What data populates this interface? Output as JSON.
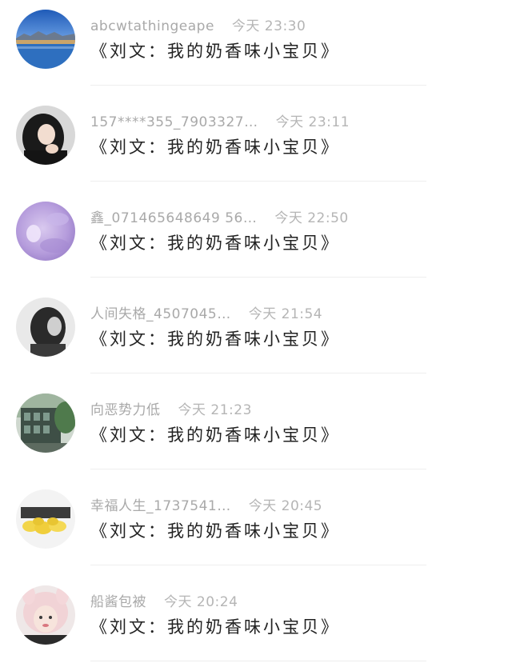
{
  "comments": [
    {
      "username": "abcwtathingeape",
      "time": "今天 23:30",
      "text": "《刘文：我的奶香味小宝贝》",
      "avatar": "avatar-lake-mountain-icon"
    },
    {
      "username": "157****355_7903327…",
      "time": "今天 23:11",
      "text": "《刘文：我的奶香味小宝贝》",
      "avatar": "avatar-girl-dark-hair-icon"
    },
    {
      "username": "鑫_071465648649 56…",
      "time": "今天 22:50",
      "text": "《刘文：我的奶香味小宝贝》",
      "avatar": "avatar-purple-moon-icon"
    },
    {
      "username": "人间失格_4507045…",
      "time": "今天 21:54",
      "text": "《刘文：我的奶香味小宝贝》",
      "avatar": "avatar-bw-portrait-icon"
    },
    {
      "username": "向恶势力低",
      "time": "今天 21:23",
      "text": "《刘文：我的奶香味小宝贝》",
      "avatar": "avatar-building-trees-icon"
    },
    {
      "username": "幸福人生_1737541…",
      "time": "今天 20:45",
      "text": "《刘文：我的奶香味小宝贝》",
      "avatar": "avatar-yellow-flowers-icon"
    },
    {
      "username": "船酱包被",
      "time": "今天 20:24",
      "text": "《刘文：我的奶香味小宝贝》",
      "avatar": "avatar-girl-bunny-hat-icon"
    }
  ]
}
